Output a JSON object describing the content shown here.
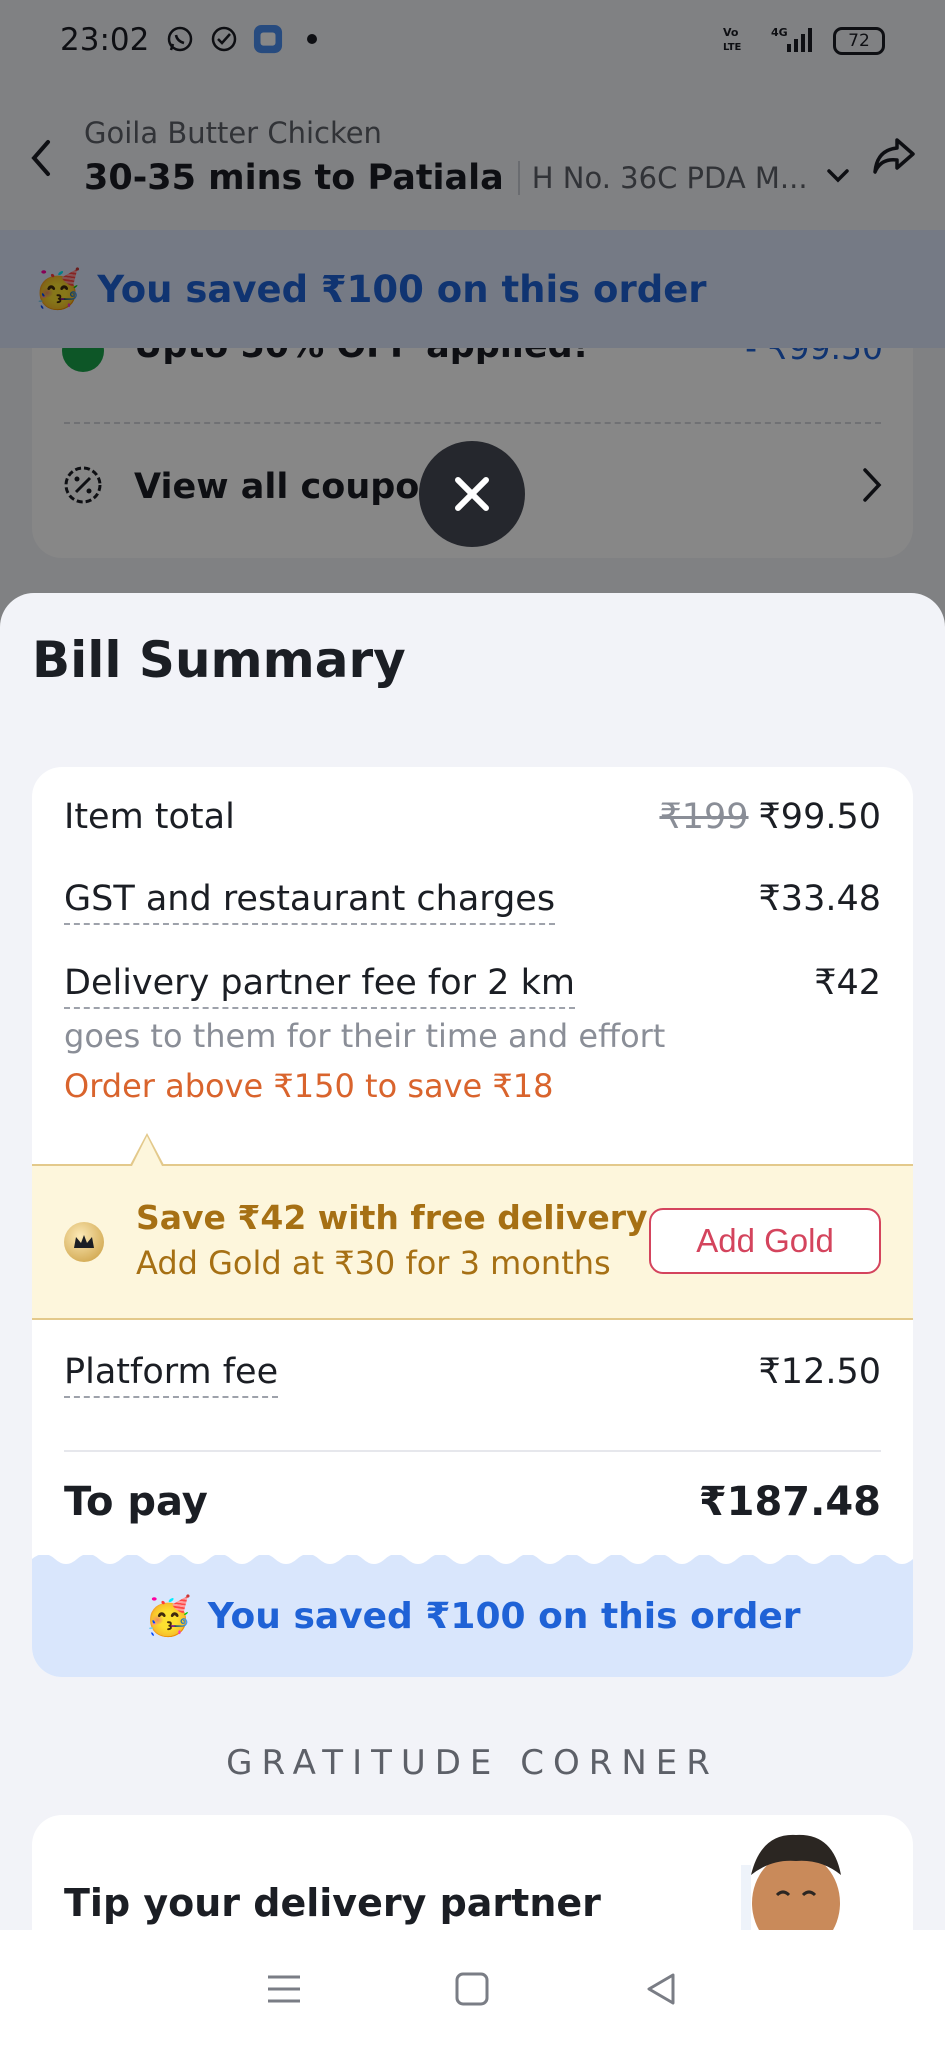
{
  "status_bar": {
    "time": "23:02",
    "battery": "72",
    "network": "4G",
    "volte": "Vo LTE",
    "icons": [
      "whatsapp-icon",
      "check-circle-icon",
      "app-icon",
      "dot-icon"
    ]
  },
  "header": {
    "restaurant": "Goila Butter Chicken",
    "eta": "30-35 mins to Patiala",
    "address": "H No. 36C PDA M..."
  },
  "savings_banner": {
    "emoji": "🥳",
    "text": "You saved ₹100 on this order"
  },
  "coupons": {
    "applied_text": "Upto 50% OFF applied!",
    "applied_amount": "- ₹99.50",
    "view_all": "View all coupons"
  },
  "bill_summary": {
    "title": "Bill Summary",
    "item_total_label": "Item total",
    "item_total_original": "₹199",
    "item_total_value": "₹99.50",
    "gst_label": "GST and restaurant charges",
    "gst_value": "₹33.48",
    "delivery_label": "Delivery partner fee for 2 km",
    "delivery_value": "₹42",
    "delivery_sub": "goes to them for their time and effort",
    "delivery_promo": "Order above ₹150 to save ₹18",
    "gold": {
      "title": "Save ₹42 with free delivery",
      "subtitle": "Add Gold at ₹30 for 3 months",
      "button": "Add Gold"
    },
    "platform_label": "Platform fee",
    "platform_value": "₹12.50",
    "to_pay_label": "To pay",
    "to_pay_value": "₹187.48",
    "saved_text": "You saved ₹100 on this order"
  },
  "gratitude": {
    "heading": "GRATITUDE CORNER",
    "tip_title": "Tip your delivery partner"
  },
  "colors": {
    "accent_blue": "#1f62d6",
    "gold_text": "#a67014",
    "promo_orange": "#d9642d",
    "add_gold_red": "#d4445d"
  }
}
